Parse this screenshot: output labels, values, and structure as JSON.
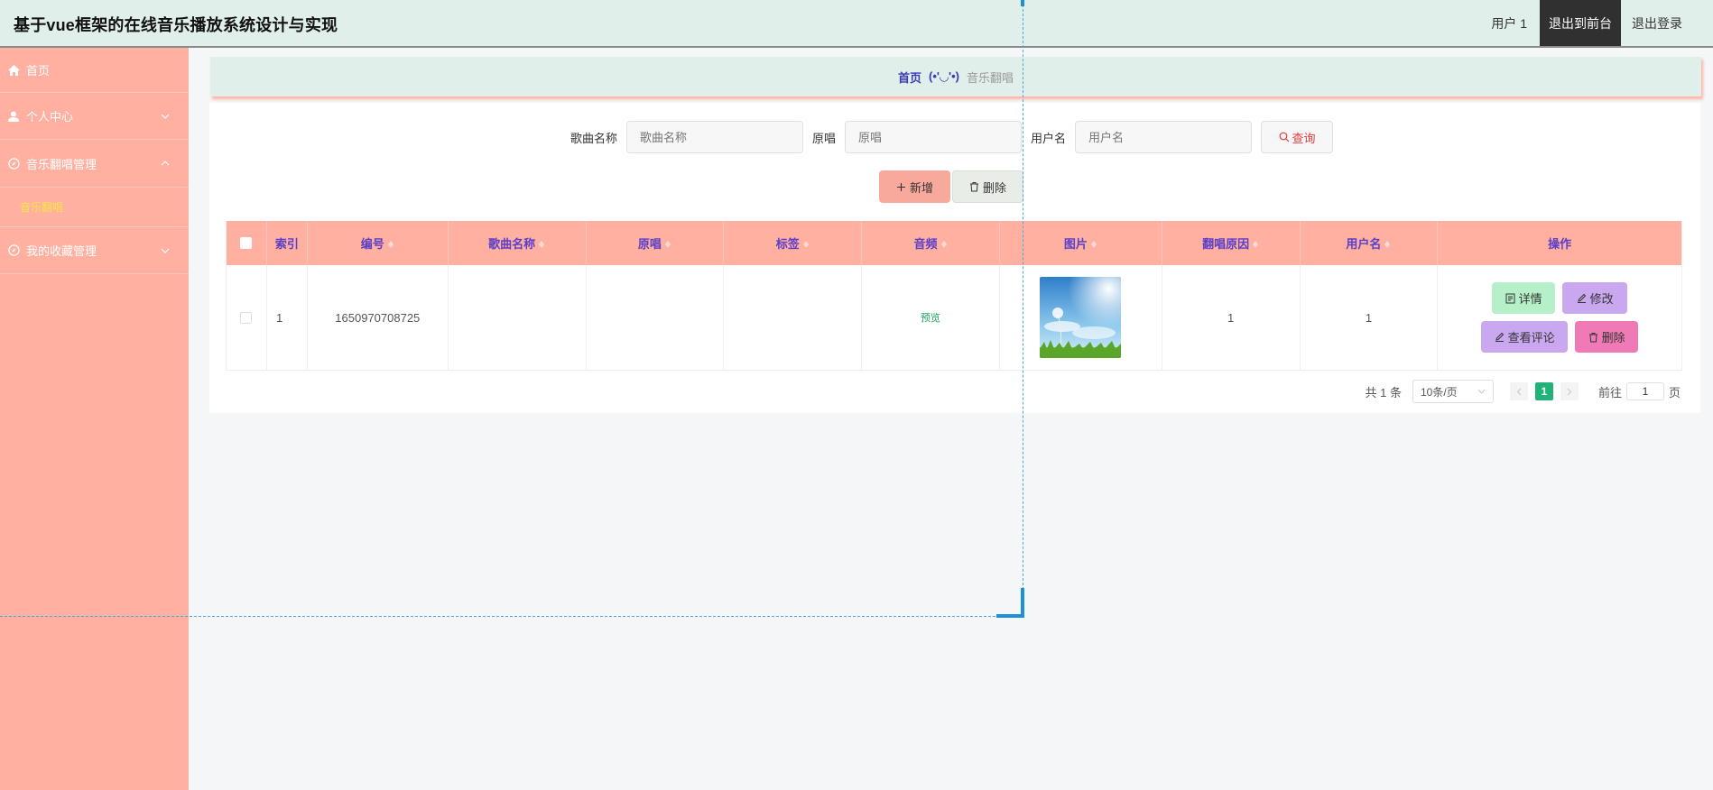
{
  "header": {
    "title": "基于vue框架的在线音乐播放系统设计与实现",
    "user": "用户 1",
    "to_front": "退出到前台",
    "logout": "退出登录"
  },
  "sidebar": {
    "items": [
      {
        "label": "首页",
        "icon": "home-icon"
      },
      {
        "label": "个人中心",
        "icon": "user-icon"
      },
      {
        "label": "音乐翻唱管理",
        "icon": "compass-icon"
      },
      {
        "label": "我的收藏管理",
        "icon": "compass-icon"
      }
    ],
    "sub_items": [
      {
        "label": "音乐翻唱"
      }
    ]
  },
  "breadcrumb": {
    "home": "首页",
    "sep": "(•'◡'•)",
    "current": "音乐翻唱"
  },
  "search": {
    "song_label": "歌曲名称",
    "song_placeholder": "歌曲名称",
    "original_label": "原唱",
    "original_placeholder": "原唱",
    "user_label": "用户名",
    "user_placeholder": "用户名",
    "query_label": "查询"
  },
  "actions": {
    "add": "新增",
    "delete": "删除"
  },
  "table": {
    "columns": [
      "索引",
      "编号",
      "歌曲名称",
      "原唱",
      "标签",
      "音频",
      "图片",
      "翻唱原因",
      "用户名",
      "操作"
    ],
    "rows": [
      {
        "index": "1",
        "id": "1650970708725",
        "song": "",
        "original": "",
        "tag": "",
        "audio": "预览",
        "reason": "1",
        "username": "1",
        "ops": {
          "detail": "详情",
          "edit": "修改",
          "comment": "查看评论",
          "delete": "删除"
        }
      }
    ]
  },
  "pagination": {
    "total": "共 1 条",
    "page_size": "10条/页",
    "current": "1",
    "goto_prefix": "前往",
    "goto_value": "1",
    "goto_suffix": "页"
  },
  "colors": {
    "sidebar": "#ffb0a0",
    "header": "#e0efe9",
    "accent": "#5a3ec8",
    "active_sub": "#f5e642"
  }
}
